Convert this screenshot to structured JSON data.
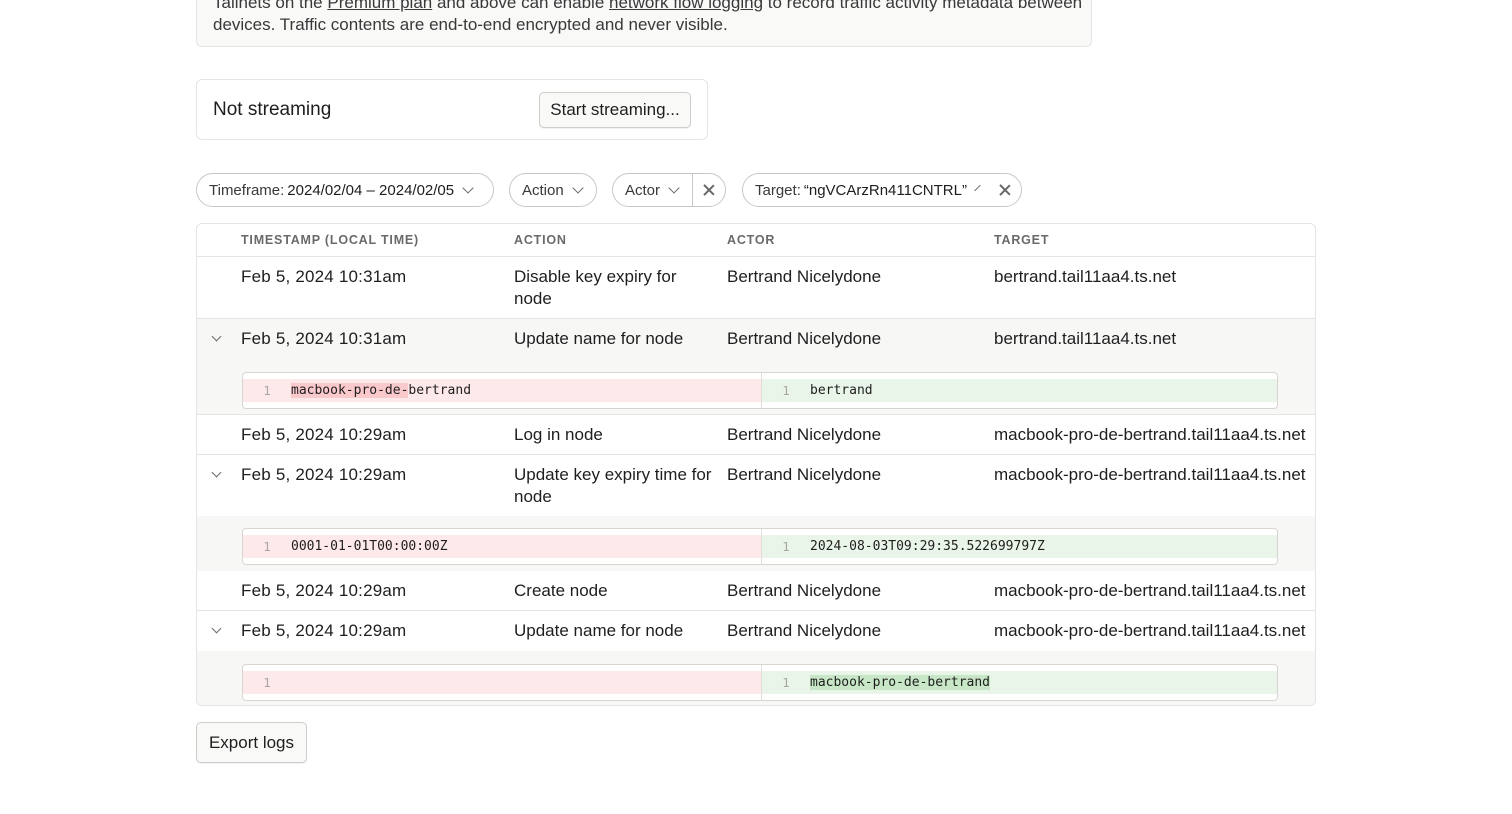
{
  "notice": {
    "line1_pre": "Tailnets on the ",
    "line1_link1": "Premium plan",
    "line1_mid": " and above can enable ",
    "line1_link2": "network flow logging",
    "line1_post": " to record traffic activity metadata between",
    "line2": "devices. Traffic contents are end-to-end encrypted and never visible."
  },
  "streaming": {
    "status": "Not streaming",
    "button_label": "Start streaming..."
  },
  "filters": {
    "timeframe_label": "Timeframe:",
    "timeframe_value": "2024/02/04 – 2024/02/05",
    "action_label": "Action",
    "actor_label": "Actor",
    "target_label": "Target:",
    "target_value": "“ngVCArzRn411CNTRL”"
  },
  "table": {
    "columns": [
      "TIMESTAMP (LOCAL TIME)",
      "ACTION",
      "ACTOR",
      "TARGET"
    ],
    "rows": [
      {
        "timestamp": "Feb 5, 2024 10:31am",
        "action": "Disable key expiry for node",
        "actor": "Bertrand Nicelydone",
        "target": "bertrand.tail11aa4.ts.net"
      },
      {
        "timestamp": "Feb 5, 2024 10:31am",
        "action": "Update name for node",
        "actor": "Bertrand Nicelydone",
        "target": "bertrand.tail11aa4.ts.net",
        "diff": {
          "old_line": "1",
          "new_line": "1",
          "old_a": "macbook-pro-de-",
          "old_b": "bertrand",
          "new_text": "bertrand"
        }
      },
      {
        "timestamp": "Feb 5, 2024 10:29am",
        "action": "Log in node",
        "actor": "Bertrand Nicelydone",
        "target": "macbook-pro-de-bertrand.tail11aa4.ts.net"
      },
      {
        "timestamp": "Feb 5, 2024 10:29am",
        "action": "Update key expiry time for node",
        "actor": "Bertrand Nicelydone",
        "target": "macbook-pro-de-bertrand.tail11aa4.ts.net",
        "diff": {
          "old_line": "1",
          "new_line": "1",
          "old_text": "0001-01-01T00:00:00Z",
          "new_text": "2024-08-03T09:29:35.522699797Z"
        }
      },
      {
        "timestamp": "Feb 5, 2024 10:29am",
        "action": "Create node",
        "actor": "Bertrand Nicelydone",
        "target": "macbook-pro-de-bertrand.tail11aa4.ts.net"
      },
      {
        "timestamp": "Feb 5, 2024 10:29am",
        "action": "Update name for node",
        "actor": "Bertrand Nicelydone",
        "target": "macbook-pro-de-bertrand.tail11aa4.ts.net",
        "diff": {
          "old_line": "1",
          "new_line": "1",
          "old_text": "",
          "new_text": "macbook-pro-de-bertrand"
        }
      }
    ]
  },
  "export": {
    "button_label": "Export logs"
  }
}
